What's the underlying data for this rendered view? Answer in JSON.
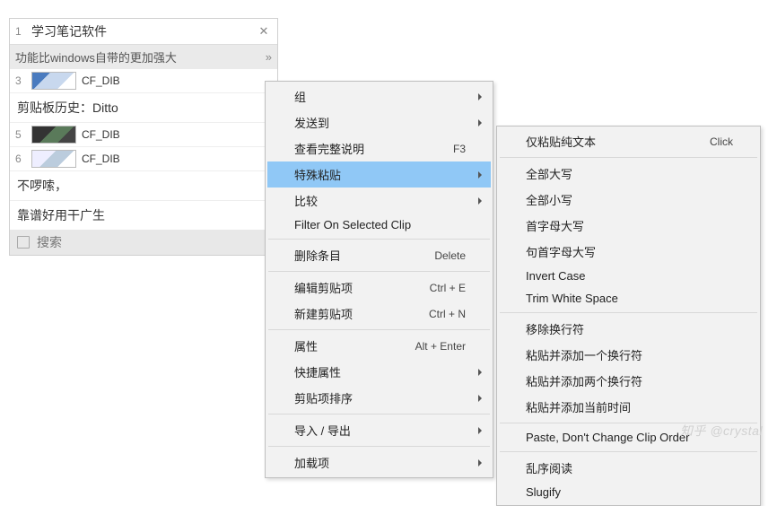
{
  "clip": {
    "title_idx": "1",
    "title": "学习笔记软件",
    "subtitle": "功能比windows自带的更加强大",
    "history_label": "剪贴板历史：Ditto",
    "footnote1": "不啰嗦，",
    "footnote2": "靠谱好用干广生"
  },
  "clipItems": [
    {
      "idx": "3",
      "thumb": "blue",
      "label": "CF_DIB"
    },
    {
      "idx": "5",
      "thumb": "dark",
      "label": "CF_DIB"
    },
    {
      "idx": "6",
      "thumb": "light",
      "label": "CF_DIB"
    }
  ],
  "search": {
    "placeholder": "搜索"
  },
  "menu1": [
    {
      "t": "item",
      "label": "组",
      "sub": true
    },
    {
      "t": "item",
      "label": "发送到",
      "sub": true
    },
    {
      "t": "item",
      "label": "查看完整说明",
      "shortcut": "F3"
    },
    {
      "t": "item",
      "label": "特殊粘贴",
      "sub": true,
      "sel": true
    },
    {
      "t": "item",
      "label": "比较",
      "sub": true
    },
    {
      "t": "item",
      "label": "Filter On Selected Clip"
    },
    {
      "t": "sep"
    },
    {
      "t": "item",
      "label": "删除条目",
      "shortcut": "Delete"
    },
    {
      "t": "sep"
    },
    {
      "t": "item",
      "label": "编辑剪贴项",
      "shortcut": "Ctrl + E"
    },
    {
      "t": "item",
      "label": "新建剪贴项",
      "shortcut": "Ctrl + N"
    },
    {
      "t": "sep"
    },
    {
      "t": "item",
      "label": "属性",
      "shortcut": "Alt + Enter"
    },
    {
      "t": "item",
      "label": "快捷属性",
      "sub": true
    },
    {
      "t": "item",
      "label": "剪贴项排序",
      "sub": true
    },
    {
      "t": "sep"
    },
    {
      "t": "item",
      "label": "导入 / 导出",
      "sub": true
    },
    {
      "t": "sep"
    },
    {
      "t": "item",
      "label": "加载项",
      "sub": true
    }
  ],
  "menu2": [
    {
      "t": "item",
      "label": "仅粘贴纯文本",
      "shortcut": "Click"
    },
    {
      "t": "sep"
    },
    {
      "t": "item",
      "label": "全部大写"
    },
    {
      "t": "item",
      "label": "全部小写"
    },
    {
      "t": "item",
      "label": "首字母大写"
    },
    {
      "t": "item",
      "label": "句首字母大写"
    },
    {
      "t": "item",
      "label": "Invert Case"
    },
    {
      "t": "item",
      "label": "Trim White Space"
    },
    {
      "t": "sep"
    },
    {
      "t": "item",
      "label": "移除换行符"
    },
    {
      "t": "item",
      "label": "粘贴并添加一个换行符"
    },
    {
      "t": "item",
      "label": "粘贴并添加两个换行符"
    },
    {
      "t": "item",
      "label": "粘贴并添加当前时间"
    },
    {
      "t": "sep"
    },
    {
      "t": "item",
      "label": "Paste, Don't Change Clip Order"
    },
    {
      "t": "sep"
    },
    {
      "t": "item",
      "label": "乱序阅读"
    },
    {
      "t": "item",
      "label": "Slugify"
    }
  ],
  "watermark": "知乎 @crystal"
}
